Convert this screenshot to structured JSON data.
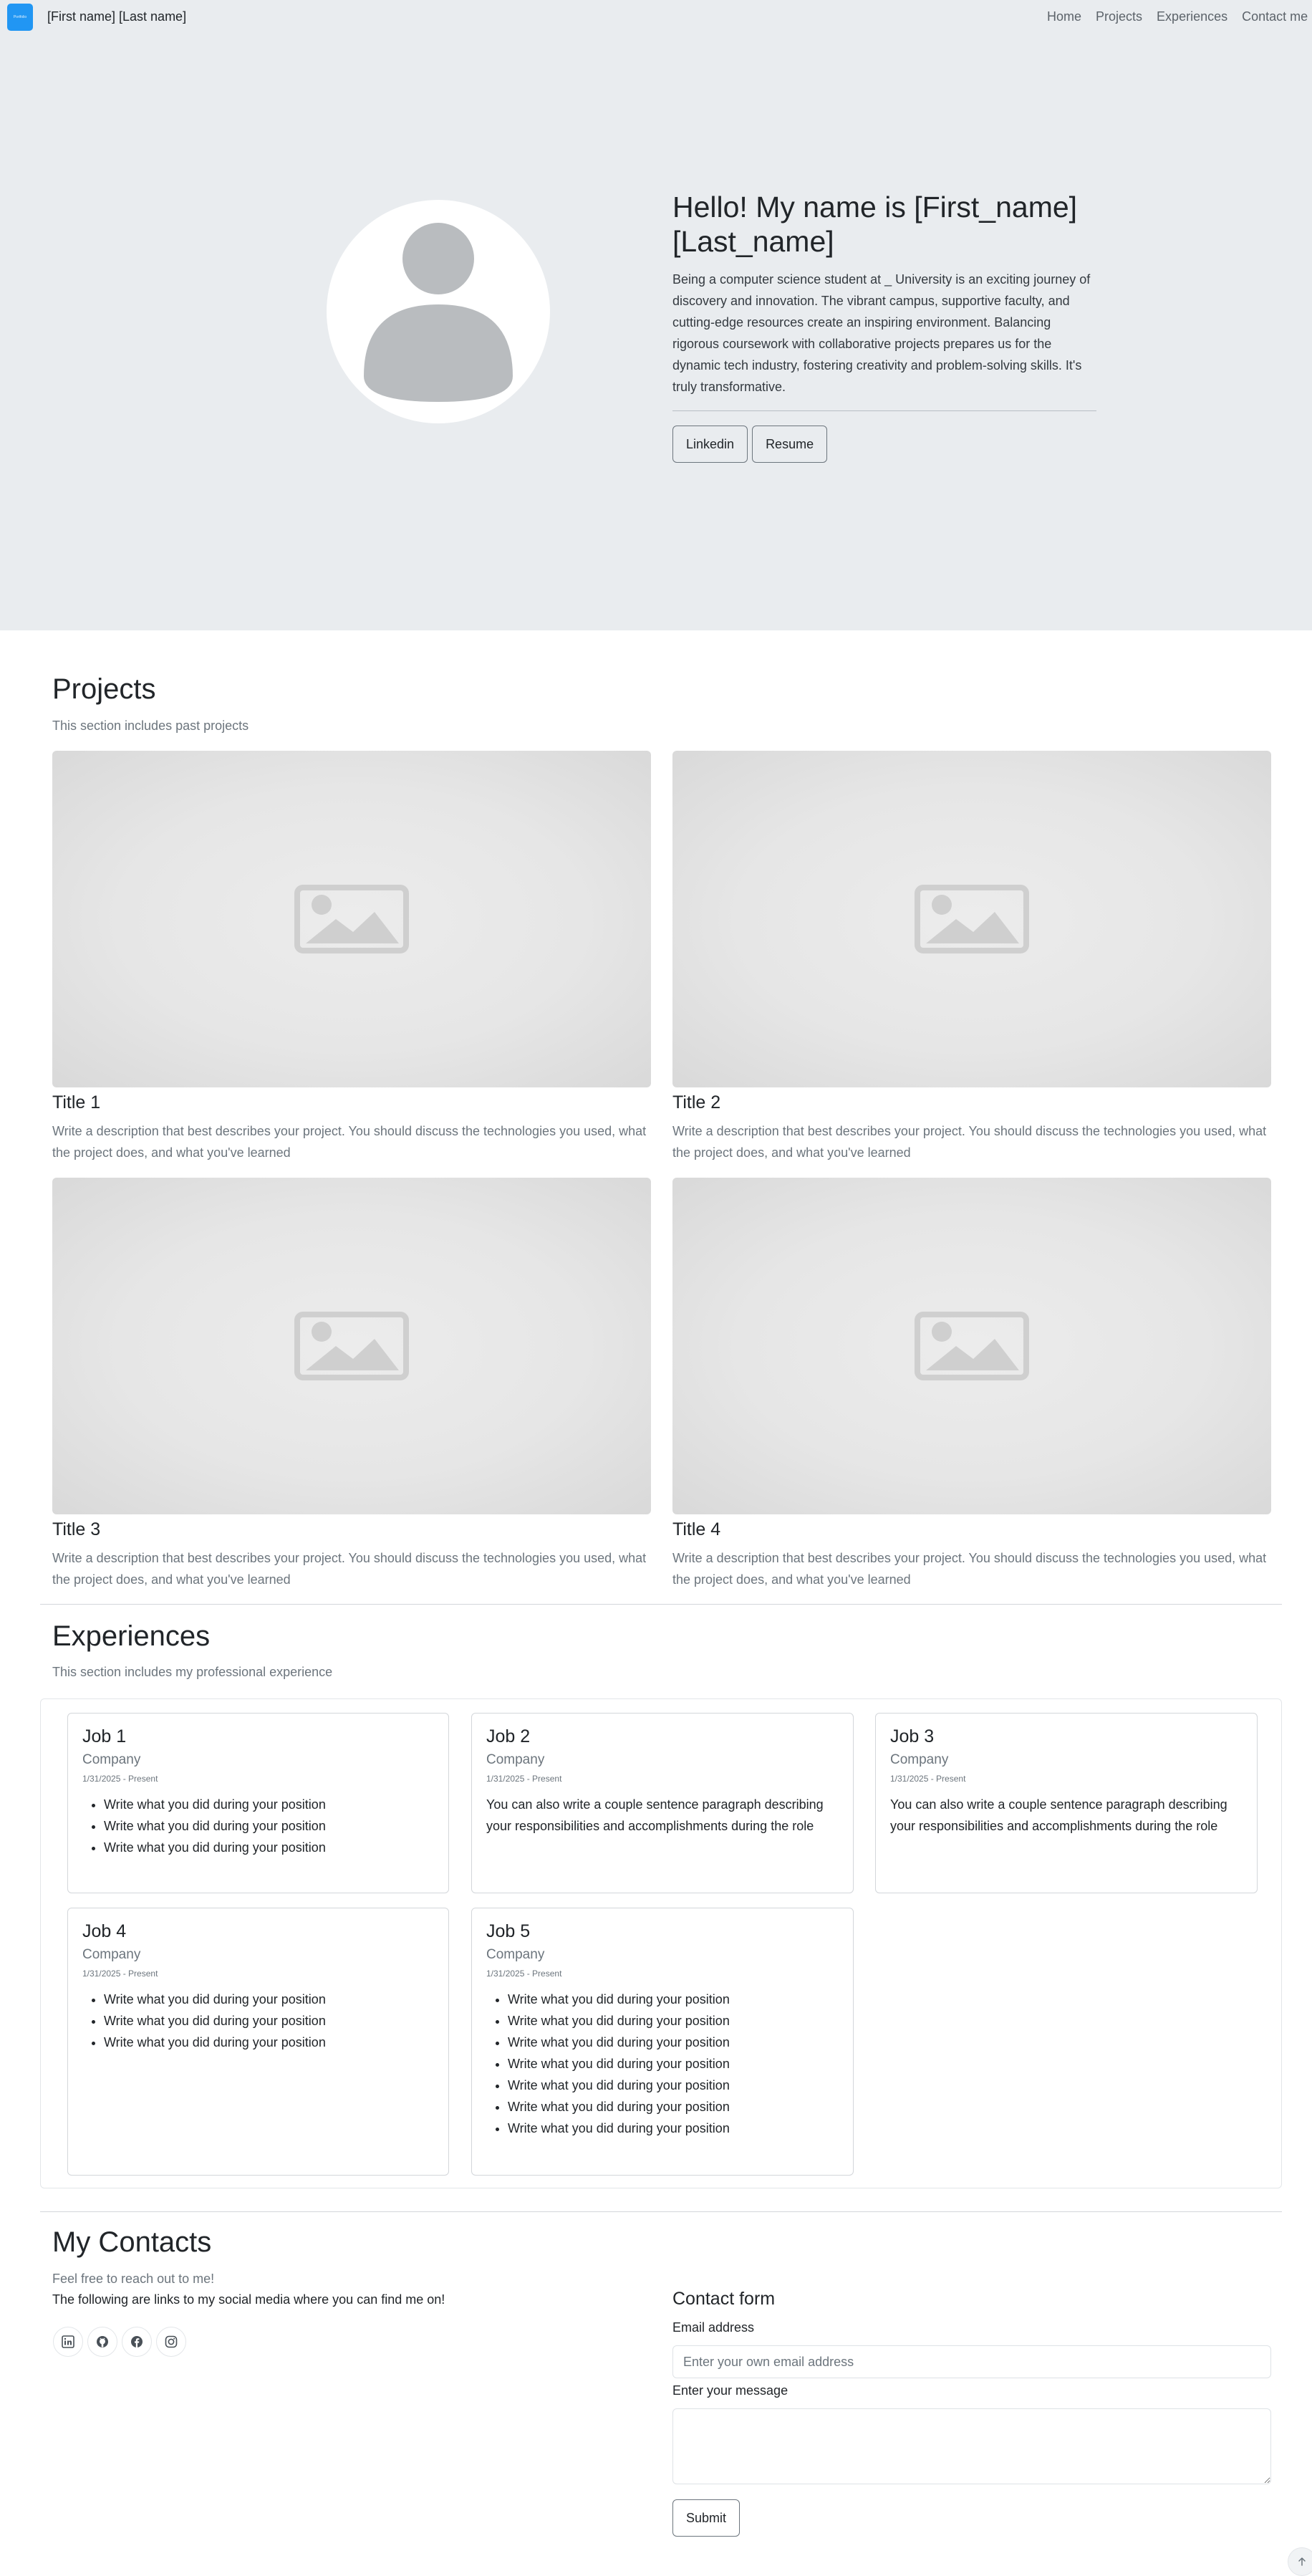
{
  "navbar": {
    "brand_logo_text": "Portfolio",
    "brand_name": "[First name] [Last name]",
    "links": [
      "Home",
      "Projects",
      "Experiences",
      "Contact me"
    ]
  },
  "hero": {
    "title": "Hello! My name is [First_name] [Last_name]",
    "description": "Being a computer science student at _ University is an exciting journey of discovery and innovation. The vibrant campus, supportive faculty, and cutting-edge resources create an inspiring environment. Balancing rigorous coursework with collaborative projects prepares us for the dynamic tech industry, fostering creativity and problem-solving skills. It's truly transformative.",
    "buttons": [
      "Linkedin",
      "Resume"
    ]
  },
  "projects": {
    "title": "Projects",
    "subtitle": "This section includes past projects",
    "items": [
      {
        "title": "Title 1",
        "description": "Write a description that best describes your project. You should discuss the technologies you used, what the project does, and what you've learned"
      },
      {
        "title": "Title 2",
        "description": "Write a description that best describes your project. You should discuss the technologies you used, what the project does, and what you've learned"
      },
      {
        "title": "Title 3",
        "description": "Write a description that best describes your project. You should discuss the technologies you used, what the project does, and what you've learned"
      },
      {
        "title": "Title 4",
        "description": "Write a description that best describes your project. You should discuss the technologies you used, what the project does, and what you've learned"
      }
    ]
  },
  "experiences": {
    "title": "Experiences",
    "subtitle": "This section includes my professional experience",
    "jobs": [
      {
        "title": "Job 1",
        "company": "Company",
        "date": "1/31/2025 - Present",
        "bullets": [
          "Write what you did during your position",
          "Write what you did during your position",
          "Write what you did during your position"
        ]
      },
      {
        "title": "Job 2",
        "company": "Company",
        "date": "1/31/2025 - Present",
        "paragraph": "You can also write a couple sentence paragraph describing your responsibilities and accomplishments during the role"
      },
      {
        "title": "Job 3",
        "company": "Company",
        "date": "1/31/2025 - Present",
        "paragraph": "You can also write a couple sentence paragraph describing your responsibilities and accomplishments during the role"
      },
      {
        "title": "Job 4",
        "company": "Company",
        "date": "1/31/2025 - Present",
        "bullets": [
          "Write what you did during your position",
          "Write what you did during your position",
          "Write what you did during your position"
        ]
      },
      {
        "title": "Job 5",
        "company": "Company",
        "date": "1/31/2025 - Present",
        "bullets": [
          "Write what you did during your position",
          "Write what you did during your position",
          "Write what you did during your position",
          "Write what you did during your position",
          "Write what you did during your position",
          "Write what you did during your position",
          "Write what you did during your position"
        ]
      }
    ]
  },
  "contacts": {
    "title": "My Contacts",
    "subtitle": "Feel free to reach out to me!",
    "social_text": "The following are links to my social media where you can find me on!",
    "social_icons": [
      "linkedin-icon",
      "github-icon",
      "facebook-icon",
      "instagram-icon"
    ],
    "form": {
      "heading": "Contact form",
      "email_label": "Email address",
      "email_placeholder": "Enter your own email address",
      "email_value": "",
      "message_label": "Enter your message",
      "message_value": "",
      "submit_label": "Submit"
    }
  },
  "colors": {
    "hero_bg": "#e9ecef",
    "brand_logo": "#2196f3",
    "muted_text": "#6c757d"
  }
}
